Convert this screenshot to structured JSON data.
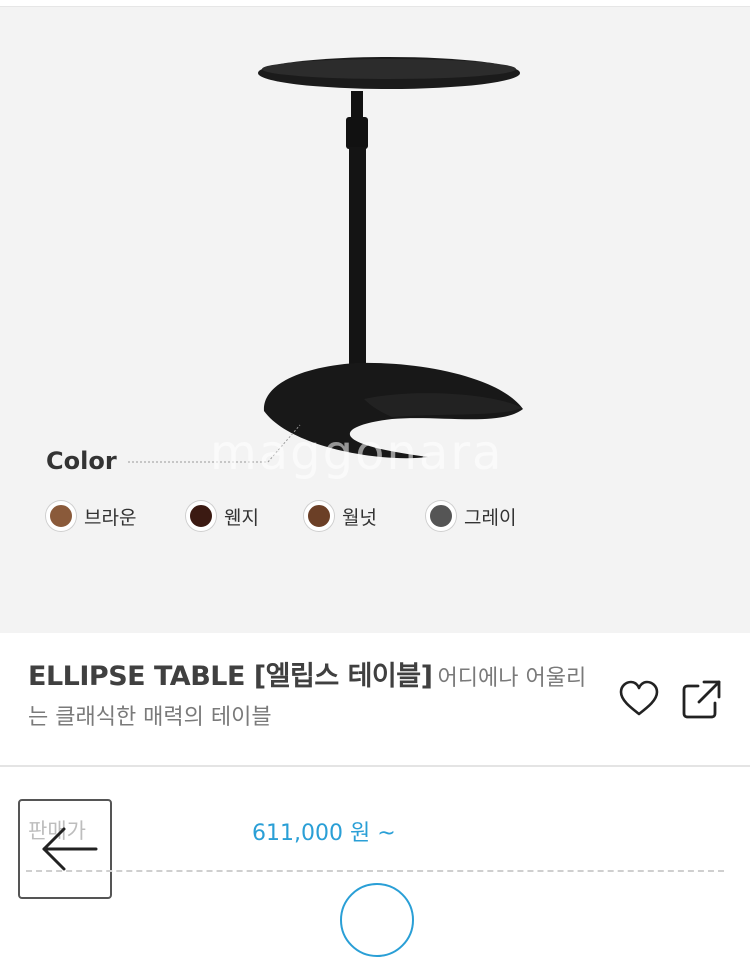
{
  "hero": {
    "watermark": "maggonara",
    "color_title": "Color",
    "colors": [
      {
        "label": "브라운",
        "hex": "#8a5a3a"
      },
      {
        "label": "웬지",
        "hex": "#3b1a12"
      },
      {
        "label": "월넛",
        "hex": "#6b3f26"
      },
      {
        "label": "그레이",
        "hex": "#555555"
      }
    ]
  },
  "product": {
    "name": "ELLIPSE TABLE [엘립스 테이블]",
    "description": "어디에나 어울리는 클래식한 매력의 테이블"
  },
  "actions": {
    "wishlist_icon": "heart-icon",
    "share_icon": "share-icon"
  },
  "price": {
    "label": "판매가",
    "value": "611,000 원 ~",
    "accent": "#2a9fd6"
  },
  "nav": {
    "back_icon": "arrow-left-icon"
  }
}
